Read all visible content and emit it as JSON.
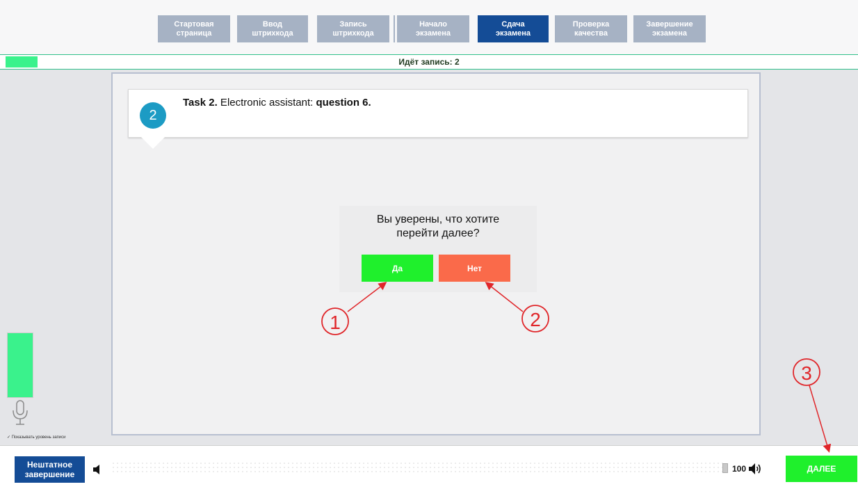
{
  "tabs": [
    {
      "label": "Стартовая\nстраница",
      "active": false
    },
    {
      "label": "Ввод\nштрихкода",
      "active": false
    },
    {
      "label": "Запись\nштрихкода",
      "active": false
    },
    {
      "label": "Начало\nэкзамена",
      "active": false
    },
    {
      "label": "Сдача\nэкзамена",
      "active": true
    },
    {
      "label": "Проверка\nкачества",
      "active": false
    },
    {
      "label": "Завершение\nэкзамена",
      "active": false
    }
  ],
  "recording": {
    "label": "Идёт запись: 2"
  },
  "task": {
    "number": "2",
    "title_bold": "Task 2.",
    "title_text": " Electronic assistant: ",
    "title_question": "question 6."
  },
  "dialog": {
    "question": "Вы уверены, что хотите\nперейти далее?",
    "yes_label": "Да",
    "no_label": "Нет"
  },
  "annotations": {
    "one": "1",
    "two": "2",
    "three": "3"
  },
  "sidebar": {
    "show_level_label": "✓ Показывать уровень записи"
  },
  "bottom": {
    "emergency_label": "Нештатное\nзавершение",
    "volume_value": "100",
    "next_label": "ДАЛЕЕ"
  },
  "colors": {
    "active_tab": "#144c96",
    "inactive_tab": "#a6b2c4",
    "yes": "#1ff02c",
    "no": "#fa6a4a",
    "annotation": "#e0262a"
  }
}
